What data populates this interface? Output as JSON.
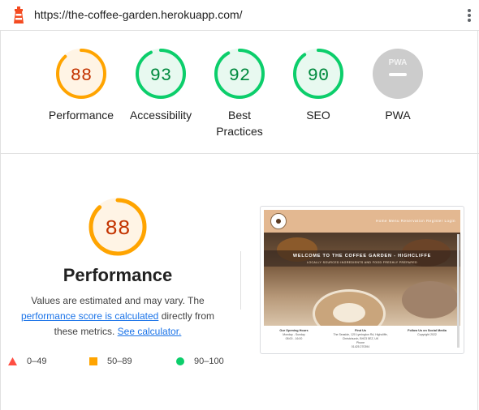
{
  "browser": {
    "url": "https://the-coffee-garden.herokuapp.com/",
    "logo_icon": "lighthouse-icon",
    "menu_icon": "kebab-menu-icon"
  },
  "scores": [
    {
      "label": "Performance",
      "value": "88",
      "score": 88,
      "status": "average"
    },
    {
      "label": "Accessibility",
      "value": "93",
      "score": 93,
      "status": "pass"
    },
    {
      "label": "Best Practices",
      "value": "92",
      "score": 92,
      "status": "pass"
    },
    {
      "label": "SEO",
      "value": "90",
      "score": 90,
      "status": "pass"
    },
    {
      "label": "PWA",
      "value": "PWA",
      "score": null,
      "status": "na"
    }
  ],
  "colors": {
    "pass": "#0cce6b",
    "pass_text": "#008a3e",
    "pass_bg": "#e8f9f0",
    "average": "#ffa400",
    "average_text": "#c33300",
    "average_bg": "#fff4e5",
    "fail": "#ff4e42",
    "na": "#cccccc",
    "link": "#1a73e8"
  },
  "performance": {
    "score_text": "88",
    "score": 88,
    "title": "Performance",
    "desc_part1": "Values are estimated and may vary. The ",
    "desc_link1": "performance score is calculated",
    "desc_part2": " directly from these metrics. ",
    "desc_link2": "See calculator."
  },
  "legend": [
    {
      "shape": "triangle",
      "label": "0–49"
    },
    {
      "shape": "square",
      "label": "50–89"
    },
    {
      "shape": "circle",
      "label": "90–100"
    }
  ],
  "screenshot": {
    "menu": "Home  Menu  Reservation  Register  Login",
    "hero_title": "WELCOME TO THE COFFEE GARDEN - HIGHCLIFFE",
    "hero_subtitle": "LOCALLY SOURCED INGREDIENTS AND FOOD FRESHLY PREPARED",
    "col1_title": "Our Opening Hours",
    "col1_line1": "Monday - Sunday",
    "col1_line2": "08:00 - 16:00",
    "col2_title": "Find Us",
    "col2_line1": "The Seaside, 120 Lymington Rd, Highcliffe,",
    "col2_line2": "Christchurch, BH23 5EZ, UK",
    "col2_line3": "Phone",
    "col2_line4": "01425 270394",
    "col3_title": "Follow Us on Social Media",
    "col3_line1": "Copyright 2022"
  }
}
